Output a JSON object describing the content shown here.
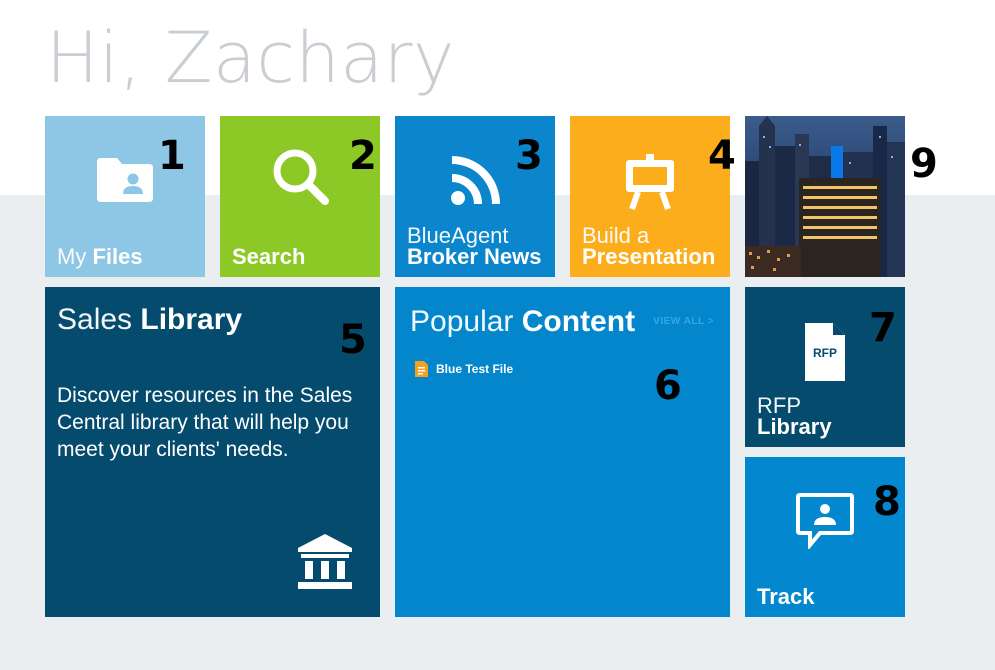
{
  "greeting": "Hi, Zachary",
  "colors": {
    "my_files": "#8ec6e6",
    "search": "#8cc826",
    "news": "#0b86cc",
    "presentation": "#fcad1b",
    "dark_navy": "#054b6d",
    "popular": "#0386cc",
    "track": "#0388cf",
    "background": "#ebeef0"
  },
  "tiles": {
    "my_files": {
      "light": "My",
      "bold": "Files",
      "number": "1",
      "icon": "folder-user-icon"
    },
    "search": {
      "bold": "Search",
      "number": "2",
      "icon": "search-icon"
    },
    "news": {
      "light": "BlueAgent",
      "bold": "Broker News",
      "number": "3",
      "icon": "rss-icon"
    },
    "presentation": {
      "light": "Build a",
      "bold": "Presentation",
      "number": "4",
      "icon": "easel-icon"
    },
    "sales_library": {
      "light": "Sales",
      "bold": "Library",
      "number": "5",
      "description": "Discover resources in the Sales Central library that will help you meet your clients' needs.",
      "icon": "bank-icon"
    },
    "popular_content": {
      "light": "Popular",
      "bold": "Content",
      "number": "6",
      "view_all": "VIEW ALL >",
      "items": [
        {
          "label": "Blue Test File",
          "icon": "document-icon"
        }
      ]
    },
    "rfp_library": {
      "light": "RFP",
      "bold": "Library",
      "number": "7",
      "icon_text": "RFP",
      "icon": "rfp-document-icon"
    },
    "track": {
      "bold": "Track",
      "number": "8",
      "icon": "chat-user-icon"
    },
    "city_image": {
      "number": "9"
    }
  }
}
